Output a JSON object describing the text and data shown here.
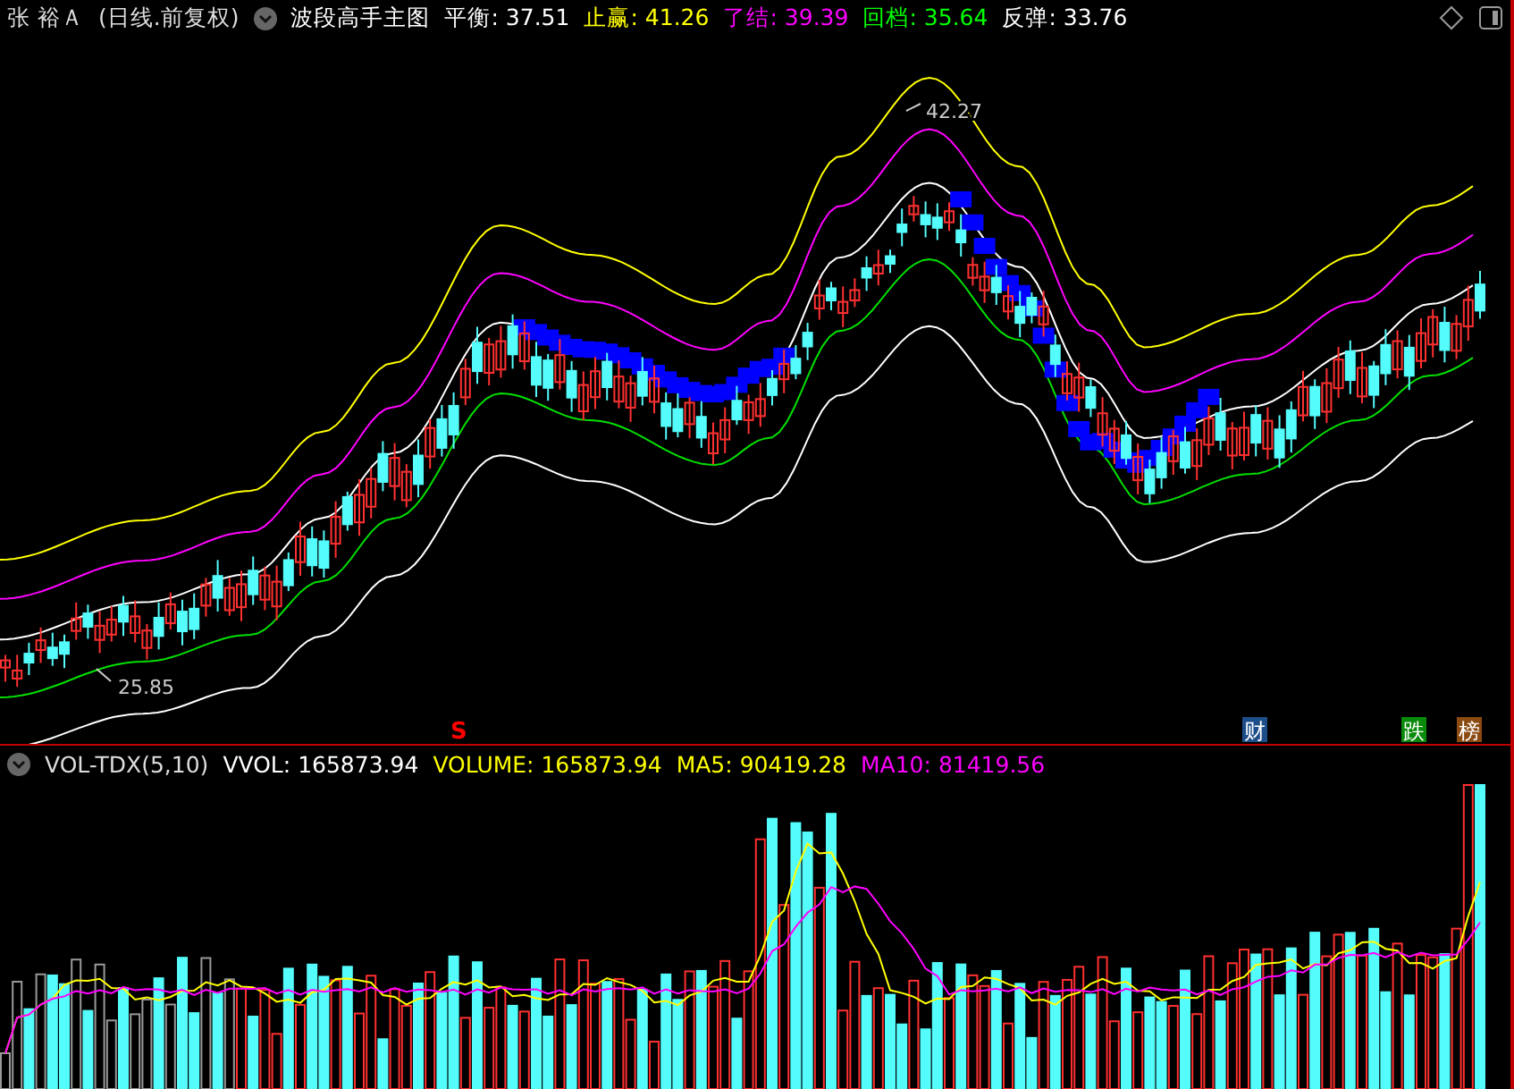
{
  "header": {
    "stock": "张 裕Ａ",
    "period": "(日线.前复权)",
    "indicator": "波段高手主图",
    "readings": [
      {
        "label": "平衡:",
        "value": "37.51",
        "color": "#ffffff"
      },
      {
        "label": "止赢:",
        "value": "41.26",
        "color": "#ffff00"
      },
      {
        "label": "了结:",
        "value": "39.39",
        "color": "#ff00ff"
      },
      {
        "label": "回档:",
        "value": "35.64",
        "color": "#00ff00"
      },
      {
        "label": "反弹:",
        "value": "33.76",
        "color": "#ffffff"
      }
    ]
  },
  "price_chart": {
    "high_label": "42.27",
    "low_label": "25.85",
    "markers": [
      {
        "text": "S",
        "kind": "signal",
        "color": "#ff0000"
      },
      {
        "text": "财",
        "kind": "badge",
        "color": "#1d4e89"
      },
      {
        "text": "跌",
        "kind": "badge",
        "color": "#0a8a0a"
      },
      {
        "text": "榜",
        "kind": "badge",
        "color": "#8a4a10"
      }
    ]
  },
  "volume": {
    "indicator": "VOL-TDX(5,10)",
    "readings": [
      {
        "label": "VVOL:",
        "value": "165873.94",
        "color": "#ffffff"
      },
      {
        "label": "VOLUME:",
        "value": "165873.94",
        "color": "#ffff00"
      },
      {
        "label": "MA5:",
        "value": "90419.28",
        "color": "#ffff00"
      },
      {
        "label": "MA10:",
        "value": "81419.56",
        "color": "#ff00ff"
      }
    ]
  }
}
